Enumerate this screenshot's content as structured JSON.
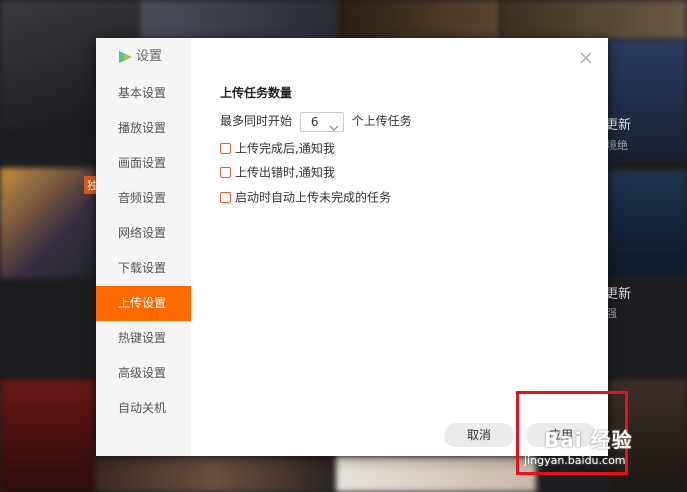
{
  "sidebar": {
    "title": "设置",
    "items": [
      {
        "label": "基本设置",
        "active": false
      },
      {
        "label": "播放设置",
        "active": false
      },
      {
        "label": "画面设置",
        "active": false
      },
      {
        "label": "音频设置",
        "active": false
      },
      {
        "label": "网络设置",
        "active": false
      },
      {
        "label": "下载设置",
        "active": false
      },
      {
        "label": "上传设置",
        "active": true
      },
      {
        "label": "热键设置",
        "active": false
      },
      {
        "label": "高级设置",
        "active": false
      },
      {
        "label": "自动关机",
        "active": false
      }
    ]
  },
  "content": {
    "section_title": "上传任务数量",
    "concurrent_prefix": "最多同时开始",
    "concurrent_value": "6",
    "concurrent_suffix": "个上传任务",
    "options": [
      {
        "label": "上传完成后,通知我",
        "checked": false
      },
      {
        "label": "上传出错时,通知我",
        "checked": false
      },
      {
        "label": "启动时自动上传未完成的任务",
        "checked": false
      }
    ]
  },
  "buttons": {
    "cancel": "取消",
    "apply": "应用"
  },
  "background": {
    "badge": "独",
    "texts": [
      "更新",
      "境绝",
      "更新",
      "强"
    ]
  },
  "watermark": {
    "brand": "Bai 经验",
    "url": "jingyan.baidu.com"
  },
  "colors": {
    "accent": "#ff6a00",
    "highlight": "#e8101a",
    "checkbox_border": "#e06030"
  },
  "icons": {
    "logo": "video-play-logo-icon",
    "close": "close-icon",
    "dropdown": "chevron-down-icon"
  }
}
